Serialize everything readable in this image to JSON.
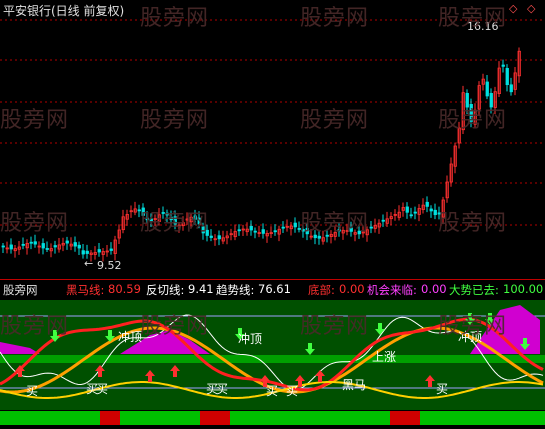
{
  "main_panel": {
    "title": "平安银行(日线 前复权)",
    "header_markers": [
      "◇",
      "◇"
    ],
    "high_label": "16.16",
    "low_label": "9.52",
    "low_arrow": "←"
  },
  "indicator_panel": {
    "name": "股旁网",
    "items": [
      {
        "label": "黑马线:",
        "value": "80.59",
        "color": "#ff3030"
      },
      {
        "label": "反切线:",
        "value": "9.41",
        "color": "#ffffff"
      },
      {
        "label": "趋势线:",
        "value": "76.61",
        "color": "#ffffff"
      },
      {
        "label": "底部:",
        "value": "0.00",
        "color": "#ff3030"
      },
      {
        "label": "机会来临:",
        "value": "0.00",
        "color": "#ff40ff"
      },
      {
        "label": "大势已去:",
        "value": "100.00",
        "color": "#40ff40"
      }
    ],
    "signals": {
      "buy": "买",
      "top": "冲顶",
      "rise": "上涨",
      "dark_horse": "黑马"
    }
  },
  "watermark": "股旁网",
  "colors": {
    "up": "#ff3030",
    "down": "#00e0e0",
    "grid": "#b00000",
    "bg": "#000000"
  }
}
